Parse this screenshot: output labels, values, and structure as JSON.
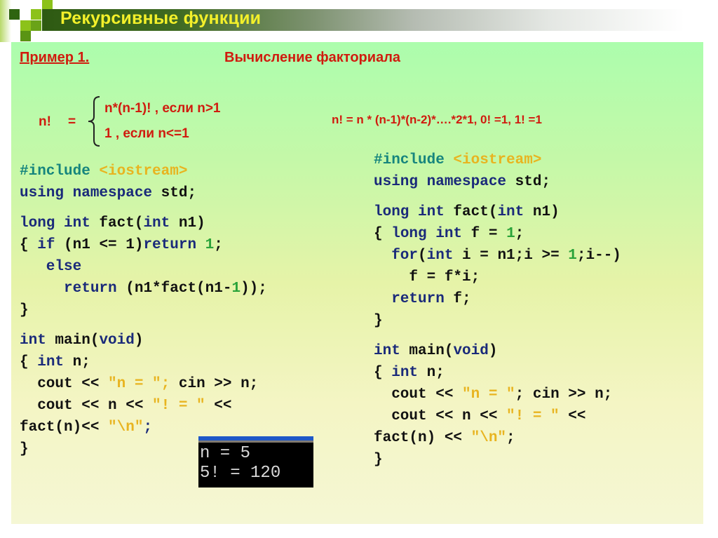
{
  "slide": {
    "title": "Рекурсивные функции",
    "accent_colors": {
      "title_text": "#f3f02a",
      "heading_red": "#d01b0e",
      "keyword_blue": "#1a2a7a",
      "preprocessor_teal": "#16857d",
      "string_yellow": "#e8b420",
      "number_green": "#2aa33a"
    }
  },
  "header": {
    "example_label": "Пример 1.",
    "topic": "Вычисление факториала"
  },
  "definition": {
    "lhs": "n!",
    "equals": "=",
    "case1": "n*(n-1)! , если n>1",
    "case2": "1 , если n<=1",
    "product_formula": "n! = n * (n-1)*(n-2)*….*2*1,  0! =1, 1! =1"
  },
  "recursive_code": {
    "lines": [
      [
        {
          "t": "#include ",
          "c": "pp"
        },
        {
          "t": "<iostream>",
          "c": "str"
        }
      ],
      [
        {
          "t": "using namespace ",
          "c": "kw"
        },
        {
          "t": "std;",
          "c": ""
        }
      ],
      [],
      [
        {
          "t": "long int ",
          "c": "kw"
        },
        {
          "t": "fact(",
          "c": ""
        },
        {
          "t": "int ",
          "c": "kw"
        },
        {
          "t": "n1)",
          "c": ""
        }
      ],
      [
        {
          "t": "{ ",
          "c": ""
        },
        {
          "t": "if ",
          "c": "kw"
        },
        {
          "t": "(n1 <= 1)",
          "c": ""
        },
        {
          "t": "return ",
          "c": "kw"
        },
        {
          "t": "1",
          "c": "num"
        },
        {
          "t": ";",
          "c": ""
        }
      ],
      [
        {
          "t": "   else",
          "c": "kw"
        }
      ],
      [
        {
          "t": "     return ",
          "c": "kw"
        },
        {
          "t": "(n1*fact(n1-",
          "c": ""
        },
        {
          "t": "1",
          "c": "num"
        },
        {
          "t": "));",
          "c": ""
        }
      ],
      [
        {
          "t": "}",
          "c": ""
        }
      ],
      [],
      [
        {
          "t": "int ",
          "c": "kw"
        },
        {
          "t": "main(",
          "c": ""
        },
        {
          "t": "void",
          "c": "kw"
        },
        {
          "t": ")",
          "c": ""
        }
      ],
      [
        {
          "t": "{ ",
          "c": ""
        },
        {
          "t": "int ",
          "c": "kw"
        },
        {
          "t": "n;",
          "c": ""
        }
      ],
      [
        {
          "t": "  cout << ",
          "c": ""
        },
        {
          "t": "\"n = \"; ",
          "c": "str"
        },
        {
          "t": "cin >> n;",
          "c": ""
        }
      ],
      [
        {
          "t": "  cout << n << ",
          "c": ""
        },
        {
          "t": "\"! = \" ",
          "c": "str"
        },
        {
          "t": "<<",
          "c": ""
        }
      ],
      [
        {
          "t": "fact(n)<< ",
          "c": ""
        },
        {
          "t": "\"\\n\"",
          "c": "str"
        },
        {
          "t": ";",
          "c": "kw"
        }
      ],
      [
        {
          "t": "}",
          "c": ""
        }
      ]
    ]
  },
  "iterative_code": {
    "lines": [
      [
        {
          "t": "#include ",
          "c": "pp"
        },
        {
          "t": "<iostream>",
          "c": "str"
        }
      ],
      [
        {
          "t": "using namespace ",
          "c": "kw"
        },
        {
          "t": "std;",
          "c": ""
        }
      ],
      [],
      [
        {
          "t": "long int ",
          "c": "kw"
        },
        {
          "t": "fact(",
          "c": ""
        },
        {
          "t": "int ",
          "c": "kw"
        },
        {
          "t": "n1)",
          "c": ""
        }
      ],
      [
        {
          "t": "{ ",
          "c": ""
        },
        {
          "t": "long int ",
          "c": "kw"
        },
        {
          "t": "f = ",
          "c": ""
        },
        {
          "t": "1",
          "c": "num"
        },
        {
          "t": ";",
          "c": ""
        }
      ],
      [
        {
          "t": "  for",
          "c": "kw"
        },
        {
          "t": "(",
          "c": ""
        },
        {
          "t": "int ",
          "c": "kw"
        },
        {
          "t": "i = n1;i >= ",
          "c": ""
        },
        {
          "t": "1",
          "c": "num"
        },
        {
          "t": ";i--)",
          "c": ""
        }
      ],
      [
        {
          "t": "    f = f*i;",
          "c": ""
        }
      ],
      [
        {
          "t": "  return ",
          "c": "kw"
        },
        {
          "t": "f;",
          "c": ""
        }
      ],
      [
        {
          "t": "}",
          "c": ""
        }
      ],
      [],
      [
        {
          "t": "int ",
          "c": "kw"
        },
        {
          "t": "main(",
          "c": ""
        },
        {
          "t": "void",
          "c": "kw"
        },
        {
          "t": ")",
          "c": ""
        }
      ],
      [
        {
          "t": "{ ",
          "c": ""
        },
        {
          "t": "int ",
          "c": "kw"
        },
        {
          "t": "n;",
          "c": ""
        }
      ],
      [
        {
          "t": "  cout << ",
          "c": ""
        },
        {
          "t": "\"n = \"",
          "c": "str"
        },
        {
          "t": "; cin >> n;",
          "c": ""
        }
      ],
      [
        {
          "t": "  cout << n << ",
          "c": ""
        },
        {
          "t": "\"! = \" ",
          "c": "str"
        },
        {
          "t": "<<",
          "c": ""
        }
      ],
      [
        {
          "t": "fact(n) << ",
          "c": ""
        },
        {
          "t": "\"\\n\"",
          "c": "str"
        },
        {
          "t": ";",
          "c": ""
        }
      ],
      [
        {
          "t": "}",
          "c": ""
        }
      ]
    ]
  },
  "console_output": {
    "line1": "n = 5",
    "line2": "5! = 120"
  }
}
